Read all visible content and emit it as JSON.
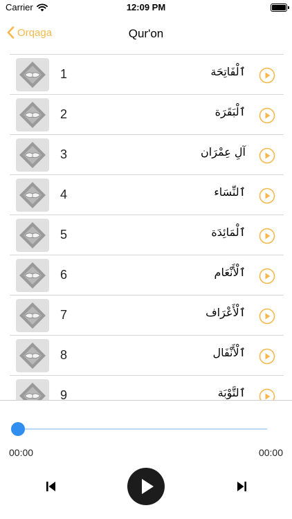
{
  "status_bar": {
    "carrier": "Carrier",
    "time": "12:09 PM",
    "battery_level": 1.0
  },
  "nav": {
    "back_label": "Orqaga",
    "title": "Qur'on"
  },
  "accent_color": "#f6b84b",
  "surahs": [
    {
      "number": "1",
      "name": "ٱلْفَاتِحَة"
    },
    {
      "number": "2",
      "name": "ٱلْبَقَرَة"
    },
    {
      "number": "3",
      "name": "آلِ عِمْرَان"
    },
    {
      "number": "4",
      "name": "ٱلنِّسَاء"
    },
    {
      "number": "5",
      "name": "ٱلْمَائِدَة"
    },
    {
      "number": "6",
      "name": "ٱلْأَنْعَام"
    },
    {
      "number": "7",
      "name": "ٱلْأَعْرَاف"
    },
    {
      "number": "8",
      "name": "ٱلْأَنْفَال"
    },
    {
      "number": "9",
      "name": "ٱلتَّوْبَة"
    }
  ],
  "player": {
    "current_time": "00:00",
    "duration": "00:00",
    "progress": 0,
    "progress_color": "#2f8ef0",
    "icons": {
      "prev": "skip-back-icon",
      "play": "play-icon",
      "next": "skip-forward-icon"
    }
  }
}
